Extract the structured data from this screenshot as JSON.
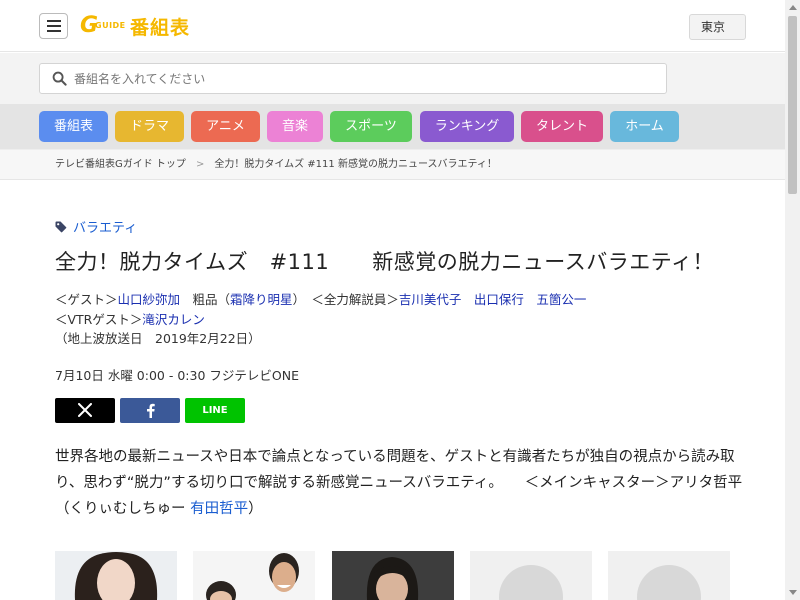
{
  "header": {
    "logo_mark": "G",
    "logo_guide": "GUIDE",
    "logo_text": "番組表",
    "region": "東京"
  },
  "search": {
    "placeholder": "番組名を入れてください",
    "value": ""
  },
  "nav": {
    "items": [
      {
        "label": "番組表",
        "color": "#5b8def"
      },
      {
        "label": "ドラマ",
        "color": "#e7b730"
      },
      {
        "label": "アニメ",
        "color": "#ec6a52"
      },
      {
        "label": "音楽",
        "color": "#ec82d5"
      },
      {
        "label": "スポーツ",
        "color": "#5ccc5c"
      },
      {
        "label": "ランキング",
        "color": "#8a5ad0"
      },
      {
        "label": "タレント",
        "color": "#d9508c"
      },
      {
        "label": "ホーム",
        "color": "#68b8dc"
      }
    ]
  },
  "breadcrumb": {
    "home": "テレビ番組表Gガイド トップ",
    "separator": ">",
    "current": "全力！脱力タイムズ #111 新感覚の脱力ニュースバラエティ！"
  },
  "program": {
    "genre": "バラエティ",
    "title": "全力！脱力タイムズ　#111　　新感覚の脱力ニュースバラエティ！",
    "cast": {
      "guest_prefix": "＜ゲスト＞",
      "guest1": "山口紗弥加",
      "mid1": "　粗品（",
      "guest2": "霜降り明星",
      "mid2": "）　＜全力解説員＞",
      "expert1": "吉川美代子",
      "gap1": "　",
      "expert2": "出口保行",
      "gap2": "　",
      "expert3": "五箇公一",
      "vtr_prefix": "＜VTRゲスト＞",
      "vtr_guest": "滝沢カレン",
      "air_note": "（地上波放送日　2019年2月22日）"
    },
    "airtime": "7月10日 水曜 0:00  - 0:30 フジテレビONE",
    "description_prefix": "世界各地の最新ニュースや日本で論点となっている問題を、ゲストと有識者たちが独自の視点から読み取り、思わず“脱力”する切り口で解説する新感覚ニュースバラエティ。　　＜メインキャスター＞アリタ哲平（くりぃむしちゅー ",
    "description_link": "有田哲平",
    "description_suffix": "）"
  },
  "share": {
    "line_label": "LINE"
  }
}
